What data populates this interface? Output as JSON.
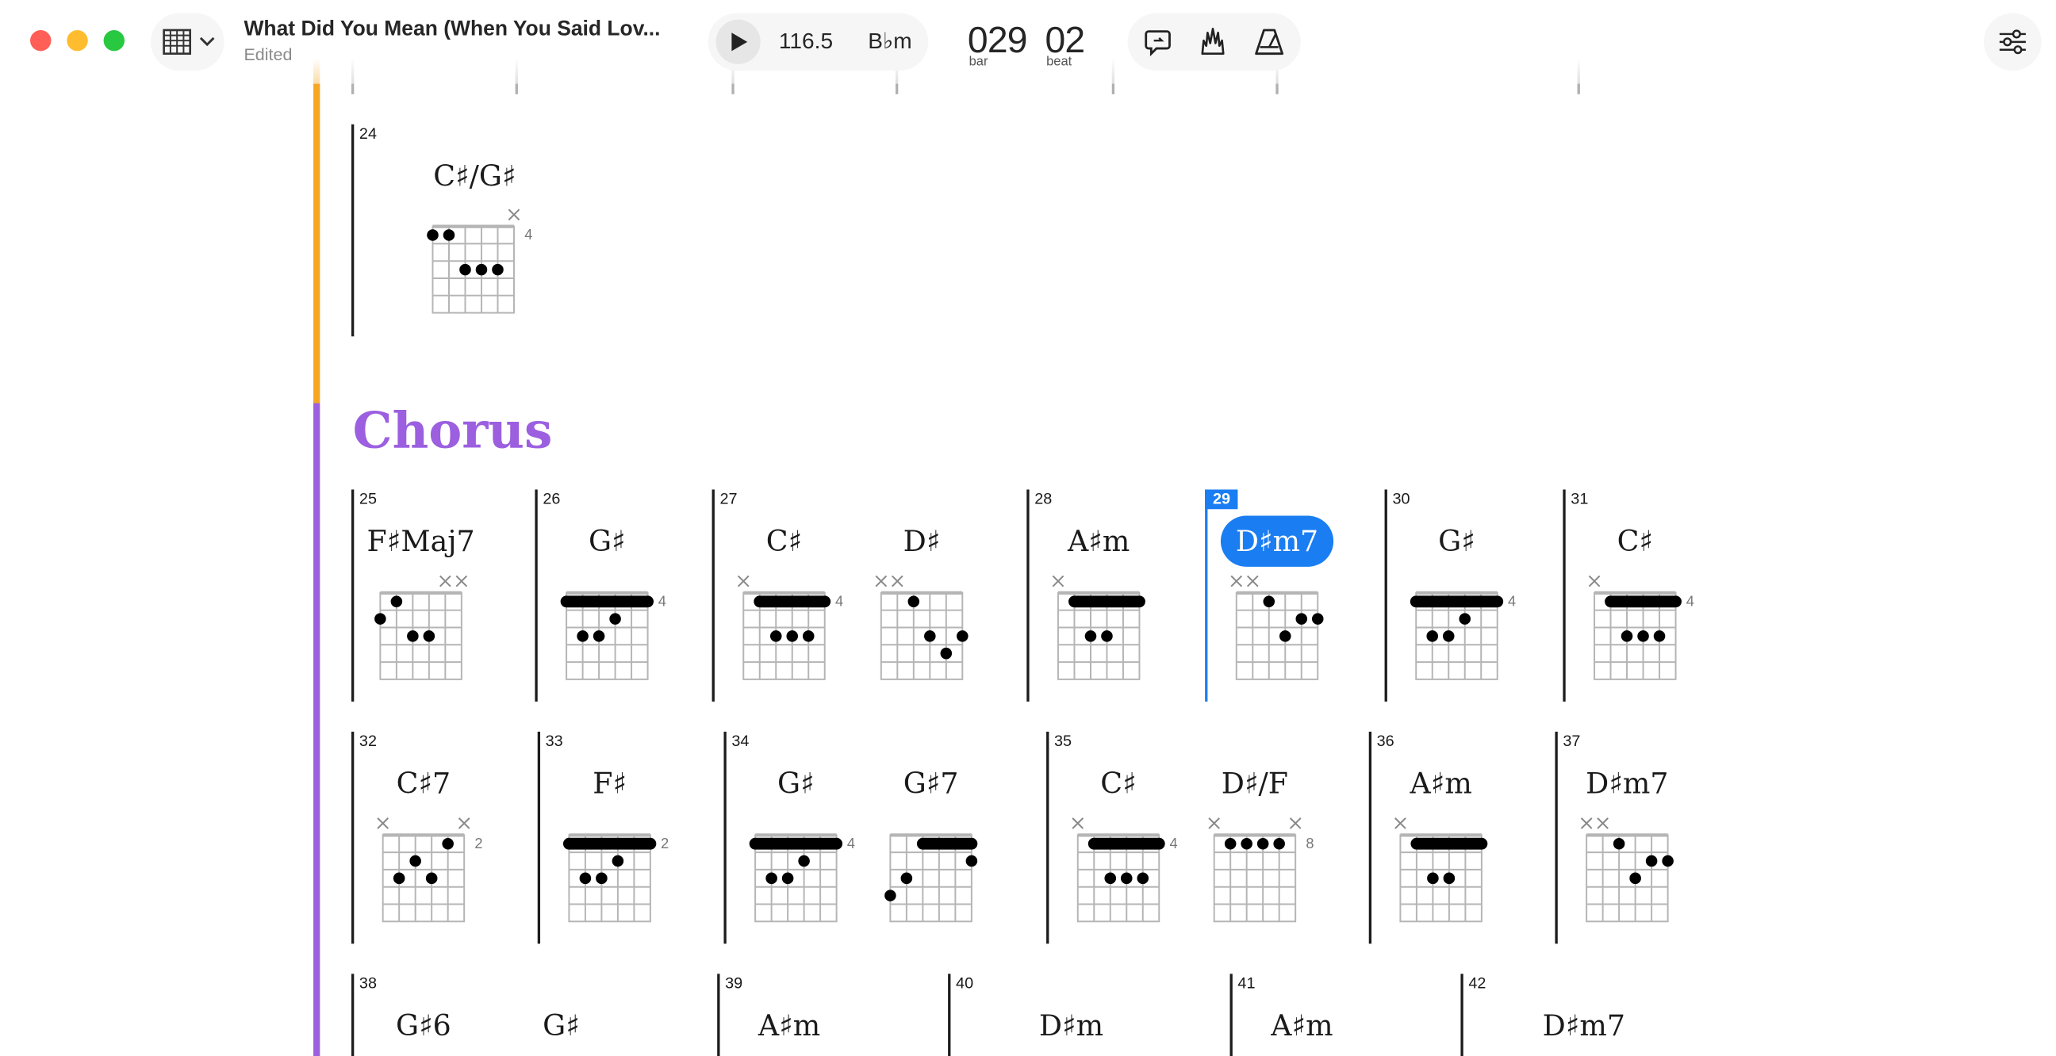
{
  "toolbar": {
    "song_title": "What Did You Mean (When You Said Lov...",
    "status": "Edited",
    "tempo": "116.5",
    "key": "B♭m",
    "bar_value": "029",
    "bar_label": "bar",
    "beat_value": "02",
    "beat_label": "beat"
  },
  "icons": [
    "chord-grid-icon",
    "chevron-down-icon",
    "play-icon",
    "lyrics-loop-icon",
    "crowd-hands-icon",
    "metronome-icon",
    "mixer-settings-icon"
  ],
  "colors": {
    "intro_section": "#f5a623",
    "chorus_section": "#9b5fe0",
    "highlight": "#1a7ef2",
    "close": "#ff5f57",
    "minimize": "#febc2e",
    "zoom": "#28c840"
  },
  "prev_section": {
    "measures": [
      {
        "num": "24",
        "chords": [
          {
            "name": "C♯/G♯",
            "fret": "4"
          }
        ]
      }
    ]
  },
  "chorus": {
    "title": "Chorus",
    "current_bar": "29",
    "row1": [
      {
        "num": "25",
        "chords": [
          {
            "name": "F♯Maj7",
            "fret": ""
          }
        ]
      },
      {
        "num": "26",
        "chords": [
          {
            "name": "G♯",
            "fret": "4"
          }
        ]
      },
      {
        "num": "27",
        "chords": [
          {
            "name": "C♯",
            "fret": "4"
          },
          {
            "name": "D♯",
            "fret": ""
          }
        ]
      },
      {
        "num": "28",
        "chords": [
          {
            "name": "A♯m",
            "fret": ""
          }
        ]
      },
      {
        "num": "29",
        "chords": [
          {
            "name": "D♯m7",
            "fret": ""
          }
        ]
      },
      {
        "num": "30",
        "chords": [
          {
            "name": "G♯",
            "fret": "4"
          }
        ]
      },
      {
        "num": "31",
        "chords": [
          {
            "name": "C♯",
            "fret": "4"
          }
        ]
      }
    ],
    "row2": [
      {
        "num": "32",
        "chords": [
          {
            "name": "C♯7",
            "fret": "2"
          }
        ]
      },
      {
        "num": "33",
        "chords": [
          {
            "name": "F♯",
            "fret": "2"
          }
        ]
      },
      {
        "num": "34",
        "chords": [
          {
            "name": "G♯",
            "fret": "4"
          },
          {
            "name": "G♯7",
            "fret": ""
          }
        ]
      },
      {
        "num": "35",
        "chords": [
          {
            "name": "C♯",
            "fret": "4"
          },
          {
            "name": "D♯/F",
            "fret": "8"
          }
        ]
      },
      {
        "num": "36",
        "chords": [
          {
            "name": "A♯m",
            "fret": ""
          }
        ]
      },
      {
        "num": "37",
        "chords": [
          {
            "name": "D♯m7",
            "fret": ""
          }
        ]
      }
    ],
    "row3": [
      {
        "num": "38",
        "chords": [
          {
            "name": "G♯6"
          },
          {
            "name": "G♯"
          }
        ]
      },
      {
        "num": "39",
        "chords": [
          {
            "name": "A♯m"
          }
        ]
      },
      {
        "num": "40",
        "chords": [
          {
            "name": "D♯m"
          }
        ]
      },
      {
        "num": "41",
        "chords": [
          {
            "name": "A♯m"
          }
        ]
      },
      {
        "num": "42",
        "chords": [
          {
            "name": "D♯m7"
          }
        ]
      }
    ]
  }
}
